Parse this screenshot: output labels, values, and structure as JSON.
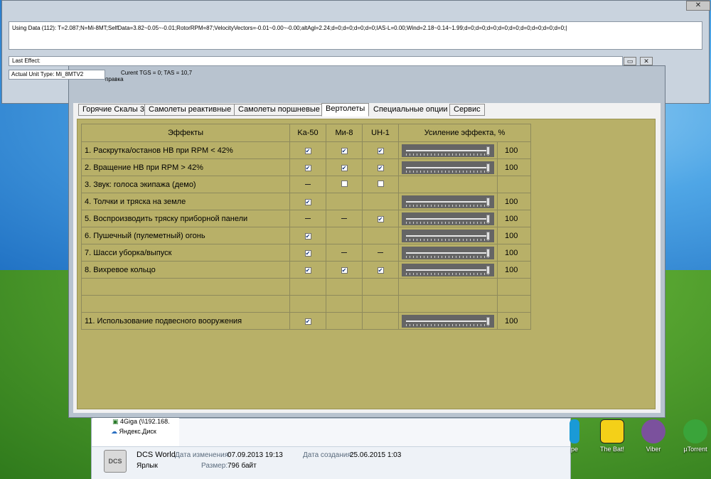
{
  "log": {
    "close_label": "✕",
    "data_text": "Using Data (112): T=2.087;N=Mi-8MT;SelfData=3.82~0.05~-0.01;RotorRPM=87;VelocityVectors=-0.01~0.00~-0.00;altAgl=2.24;d=0;d=0;d=0;d=0;IAS-L=0.00;Wind=2.18~0.14~1.99;d=0;d=0;d=0;d=0;d=0;d=0;d=0;d=0;d=0;|",
    "last_effect_label": "Last Effect:",
    "unit_type_label": "Actual Unit Type: Mi_8MTV2",
    "tgs_text": "Curent TGS = 0; TAS = 10,7",
    "menu_fragment": "правка",
    "min_label": "▭",
    "close_small_label": "✕"
  },
  "tabs": [
    {
      "label": "Горячие Скалы 3"
    },
    {
      "label": "Самолеты реактивные"
    },
    {
      "label": "Самолеты поршневые"
    },
    {
      "label": "Вертолеты"
    },
    {
      "label": "Специальные опции"
    },
    {
      "label": "Сервис"
    }
  ],
  "table": {
    "headers": [
      "Эффекты",
      "Ka-50",
      "Ми-8",
      "UH-1",
      "Усиление эффекта, %"
    ],
    "rows": [
      {
        "label": "1. Раскрутка/останов НВ при RPM < 42%",
        "ka50": "check",
        "mi8": "check",
        "uh1": "check",
        "gain": 100
      },
      {
        "label": "2. Вращение НВ при RPM > 42%",
        "ka50": "check",
        "mi8": "check",
        "uh1": "check",
        "gain": 100
      },
      {
        "label": "3. Звук: голоса экипажа (демо)",
        "ka50": "dash",
        "mi8": "empty",
        "uh1": "empty",
        "gain": null
      },
      {
        "label": "4. Толчки и тряска на земле",
        "ka50": "check",
        "mi8": "none",
        "uh1": "none",
        "gain": 100
      },
      {
        "label": "5. Воспроизводить тряску приборной панели",
        "ka50": "dash",
        "mi8": "dash",
        "uh1": "check",
        "gain": 100
      },
      {
        "label": "6. Пушечный (пулеметный) огонь",
        "ka50": "check",
        "mi8": "none",
        "uh1": "none",
        "gain": 100
      },
      {
        "label": "7. Шасси уборка/выпуск",
        "ka50": "check",
        "mi8": "dash",
        "uh1": "dash",
        "gain": 100
      },
      {
        "label": "8. Вихревое кольцо",
        "ka50": "check",
        "mi8": "check",
        "uh1": "check",
        "gain": 100
      },
      {
        "label": "",
        "ka50": "none",
        "mi8": "none",
        "uh1": "none",
        "gain": null
      },
      {
        "label": "",
        "ka50": "none",
        "mi8": "none",
        "uh1": "none",
        "gain": null
      },
      {
        "label": "11. Использование подвесного вооружения",
        "ka50": "check",
        "mi8": "none",
        "uh1": "none",
        "gain": 100
      }
    ]
  },
  "explorer": {
    "tree_item_1": "4Giga (\\\\192.168.",
    "tree_item_2": "Яндекс.Диск",
    "file_name": "DCS World",
    "file_type": "Ярлык",
    "modified_label": "Дата изменения:",
    "modified_value": "07.09.2013 19:13",
    "created_label": "Дата создания:",
    "created_value": "25.06.2015 1:03",
    "size_label": "Размер:",
    "size_value": "796 байт",
    "icon_text": "DCS"
  },
  "desktop_icons": [
    {
      "label": "pe"
    },
    {
      "label": "The Bat!"
    },
    {
      "label": "Viber"
    },
    {
      "label": "µTorrent"
    }
  ]
}
